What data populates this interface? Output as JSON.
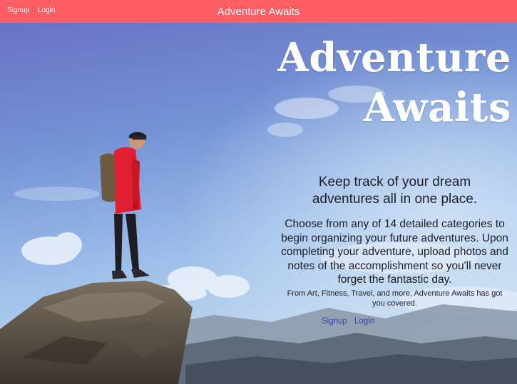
{
  "navbar": {
    "signup_label": "Signup",
    "login_label": "Login",
    "brand": "Adventure Awaits",
    "background": "#fe5d63"
  },
  "hero": {
    "title_line1": "Adventure",
    "title_line2": "Awaits",
    "tagline_line1": "Keep track of your dream",
    "tagline_line2": "adventures all in one place.",
    "description_lines": [
      "Choose from any of 14 detailed categories to",
      "begin organizing your future adventures. Upon",
      "completing your adventure, upload photos and",
      "notes of the accomplishment so you'll never",
      "forget the fantastic day."
    ],
    "small_lines": [
      "From Art, Fitness, Travel, and more, Adventure Awaits has got",
      "you covered."
    ],
    "signup_label": "Signup",
    "login_label": "Login",
    "image": "hiker standing on rocky cliff under blue sky with clouds"
  }
}
